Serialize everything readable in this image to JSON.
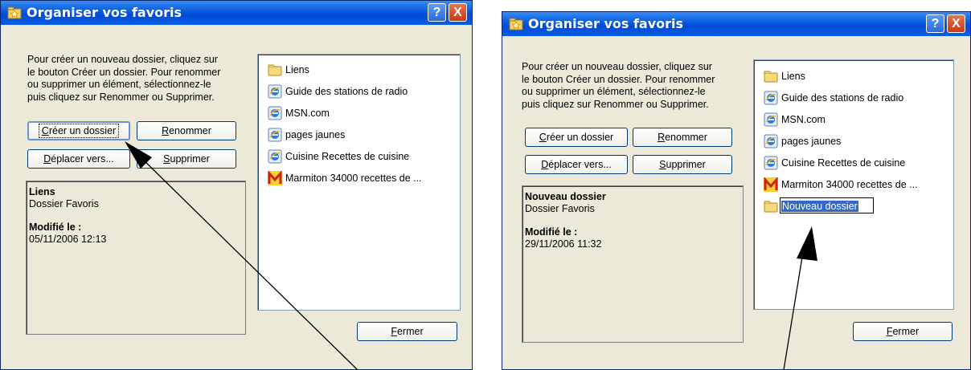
{
  "left": {
    "title": "Organiser vos favoris",
    "description": "Pour créer un nouveau dossier, cliquez sur\nle bouton Créer un dossier. Pour renommer\nou supprimer un élément, sélectionnez-le\npuis cliquez sur Renommer ou Supprimer.",
    "buttons": {
      "create_m": "C",
      "create_r": "réer un dossier",
      "rename_m": "R",
      "rename_r": "enommer",
      "move_m": "D",
      "move_r": "éplacer vers...",
      "delete_m": "S",
      "delete_r": "upprimer",
      "close_m": "F",
      "close_r": "ermer"
    },
    "info": {
      "name": "Liens",
      "type": "Dossier Favoris",
      "modified_label": "Modifié le :",
      "modified_value": "05/11/2006 12:13"
    },
    "items": [
      "Liens",
      "Guide des stations de radio",
      "MSN.com",
      "pages jaunes",
      "Cuisine  Recettes de cuisine",
      "Marmiton  34000 recettes de ..."
    ]
  },
  "right": {
    "title": "Organiser vos favoris",
    "description": "Pour créer un nouveau dossier, cliquez sur\nle bouton Créer un dossier. Pour renommer\nou supprimer un élément, sélectionnez-le\npuis cliquez sur Renommer ou Supprimer.",
    "buttons": {
      "create_m": "C",
      "create_r": "réer un dossier",
      "rename_m": "R",
      "rename_r": "enommer",
      "move_m": "D",
      "move_r": "éplacer vers...",
      "delete_m": "S",
      "delete_r": "upprimer",
      "close_m": "F",
      "close_r": "ermer"
    },
    "info": {
      "name": "Nouveau dossier",
      "type": "Dossier Favoris",
      "modified_label": "Modifié le :",
      "modified_value": "29/11/2006 11:32"
    },
    "items": [
      "Liens",
      "Guide des stations de radio",
      "MSN.com",
      "pages jaunes",
      "Cuisine  Recettes de cuisine",
      "Marmiton  34000 recettes de ...",
      "Nouveau dossier"
    ]
  },
  "icons": {
    "window": "favorites-folder-icon",
    "help": "?",
    "close": "X",
    "folder": "folder-icon",
    "ie": "internet-explorer-icon",
    "marmiton": "marmiton-icon"
  }
}
